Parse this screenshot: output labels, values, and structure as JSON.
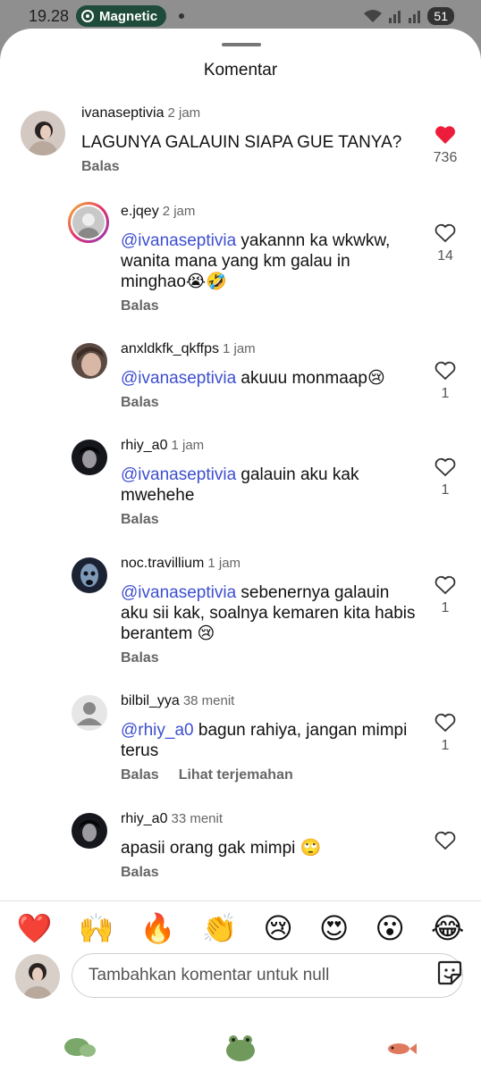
{
  "status_bar": {
    "time": "19.28",
    "app_pill": "Magnetic",
    "battery": "51"
  },
  "sheet": {
    "title": "Komentar"
  },
  "comments": [
    {
      "username": "ivanaseptivia",
      "time": "2 jam",
      "mention": "",
      "text": "LAGUNYA GALAUIN SIAPA GUE TANYA?",
      "reply": "Balas",
      "liked": true,
      "likes": "736"
    },
    {
      "username": "e.jqey",
      "time": "2 jam",
      "mention": "@ivanaseptivia",
      "text": " yakannn ka wkwkw, wanita mana yang km galau in minghao😭🤣",
      "reply": "Balas",
      "liked": false,
      "likes": "14"
    },
    {
      "username": "anxldkfk_qkffps",
      "time": "1 jam",
      "mention": "@ivanaseptivia",
      "text": " akuuu monmaap😢",
      "reply": "Balas",
      "liked": false,
      "likes": "1"
    },
    {
      "username": "rhiy_a0",
      "time": "1 jam",
      "mention": "@ivanaseptivia",
      "text": " galauin aku kak mwehehe",
      "reply": "Balas",
      "liked": false,
      "likes": "1"
    },
    {
      "username": "noc.travillium",
      "time": "1 jam",
      "mention": "@ivanaseptivia",
      "text": " sebenernya galauin aku sii kak, soalnya kemaren kita habis berantem 😢",
      "reply": "Balas",
      "liked": false,
      "likes": "1"
    },
    {
      "username": "bilbil_yya",
      "time": "38 menit",
      "mention": "@rhiy_a0",
      "text": " bagun rahiya, jangan mimpi terus",
      "reply": "Balas",
      "translate": "Lihat terjemahan",
      "liked": false,
      "likes": "1"
    },
    {
      "username": "rhiy_a0",
      "time": "33 menit",
      "mention": "",
      "text": "apasii orang gak mimpi 🙄",
      "reply": "Balas",
      "liked": false,
      "likes": ""
    }
  ],
  "emoji_bar": [
    "❤️",
    "🙌",
    "🔥",
    "👏",
    "😢",
    "😍",
    "😮",
    "😂"
  ],
  "input": {
    "placeholder": "Tambahkan komentar untuk null"
  },
  "icons": {
    "liked_color": "#ed1c3a",
    "mention_color": "#3d4fd0"
  }
}
